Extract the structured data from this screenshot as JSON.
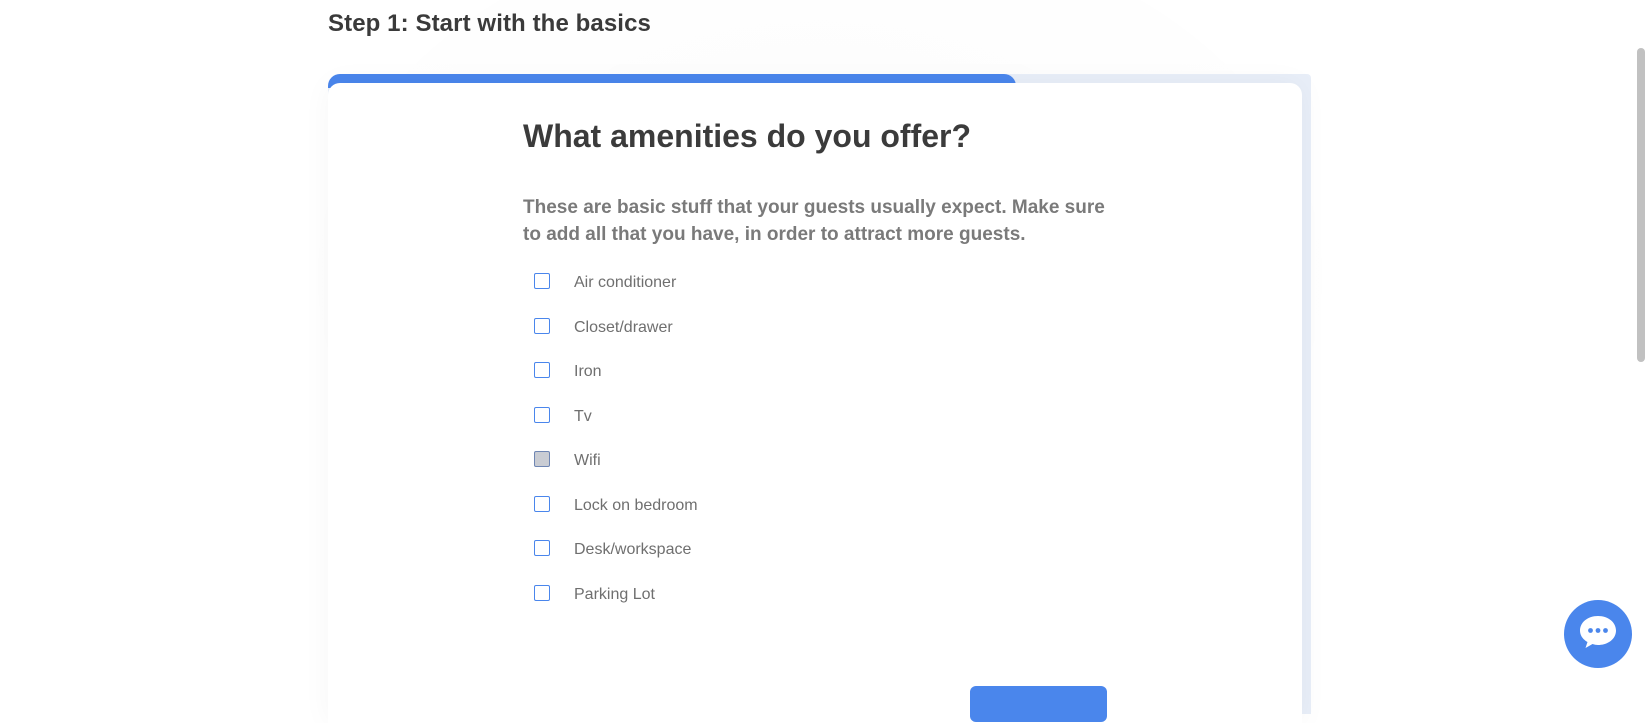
{
  "step": {
    "title": "Step 1: Start with the basics",
    "progress": 0.7
  },
  "question": {
    "title": "What amenities do you offer?",
    "description": "These are basic stuff that your guests usually expect. Make sure to add all that you have, in order to attract more guests."
  },
  "amenities": [
    {
      "label": "Air conditioner",
      "checked": false
    },
    {
      "label": "Closet/drawer",
      "checked": false
    },
    {
      "label": "Iron",
      "checked": false
    },
    {
      "label": "Tv",
      "checked": false
    },
    {
      "label": "Wifi",
      "checked": false,
      "hovered": true
    },
    {
      "label": "Lock on bedroom",
      "checked": false
    },
    {
      "label": "Desk/workspace",
      "checked": false
    },
    {
      "label": "Parking Lot",
      "checked": false
    }
  ],
  "chat": {
    "icon": "chat-bubble-icon"
  },
  "colors": {
    "accent": "#4a86ec",
    "progress_track": "#e8eef8"
  }
}
